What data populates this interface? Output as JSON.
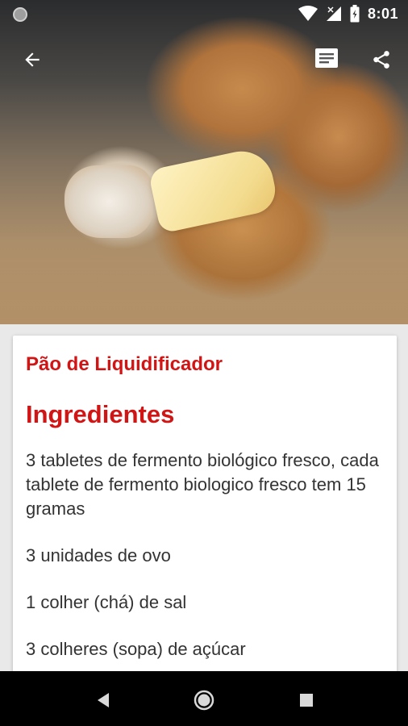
{
  "status_bar": {
    "time": "8:01",
    "icons": [
      "notification-dot-icon",
      "wifi-icon",
      "signal-icon",
      "battery-icon"
    ]
  },
  "app_bar": {
    "icons": [
      "back-arrow-icon",
      "notes-icon",
      "share-icon"
    ]
  },
  "recipe": {
    "title": "Pão de Liquidificador",
    "section_title": "Ingredientes",
    "ingredients": [
      "3 tabletes de fermento biológico fresco, cada tablete de fermento biologico fresco tem 15 gramas",
      "3 unidades de ovo",
      "1 colher (chá) de sal",
      "3 colheres (sopa) de açúcar"
    ]
  },
  "nav_bar": {
    "icons": [
      "back-triangle-icon",
      "home-circle-icon",
      "recents-square-icon"
    ]
  },
  "colors": {
    "accent": "#d11515",
    "card_background": "#ffffff",
    "page_background": "#e9e9e9",
    "nav_bar": "#000000"
  }
}
